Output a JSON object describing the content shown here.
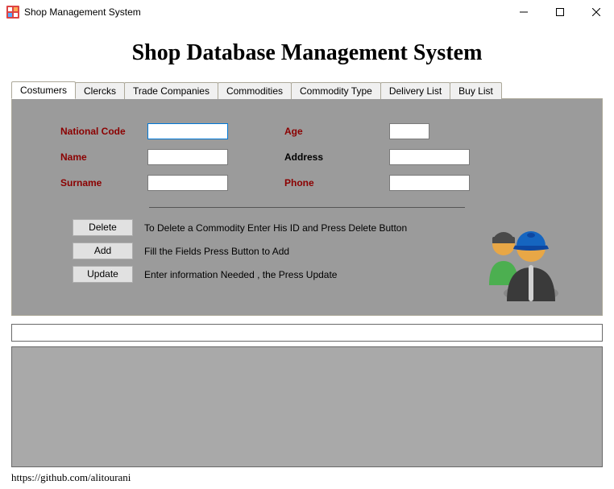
{
  "window": {
    "title": "Shop Management System"
  },
  "heading": "Shop Database Management System",
  "tabs": [
    {
      "label": "Costumers",
      "active": true
    },
    {
      "label": "Clercks",
      "active": false
    },
    {
      "label": "Trade Companies",
      "active": false
    },
    {
      "label": "Commodities",
      "active": false
    },
    {
      "label": "Commodity Type",
      "active": false
    },
    {
      "label": "Delivery List",
      "active": false
    },
    {
      "label": "Buy List",
      "active": false
    }
  ],
  "fields": {
    "national_code": {
      "label": "National Code",
      "value": ""
    },
    "name": {
      "label": "Name",
      "value": ""
    },
    "surname": {
      "label": "Surname",
      "value": ""
    },
    "age": {
      "label": "Age",
      "value": ""
    },
    "address": {
      "label": "Address",
      "value": ""
    },
    "phone": {
      "label": "Phone",
      "value": ""
    }
  },
  "actions": {
    "delete": {
      "label": "Delete",
      "desc": "To Delete a Commodity Enter His ID and Press Delete Button"
    },
    "add": {
      "label": "Add",
      "desc": "Fill the Fields  Press Button to Add"
    },
    "update": {
      "label": "Update",
      "desc": "Enter information Needed , the Press Update"
    }
  },
  "footer": {
    "url": "https://github.com/alitourani"
  }
}
